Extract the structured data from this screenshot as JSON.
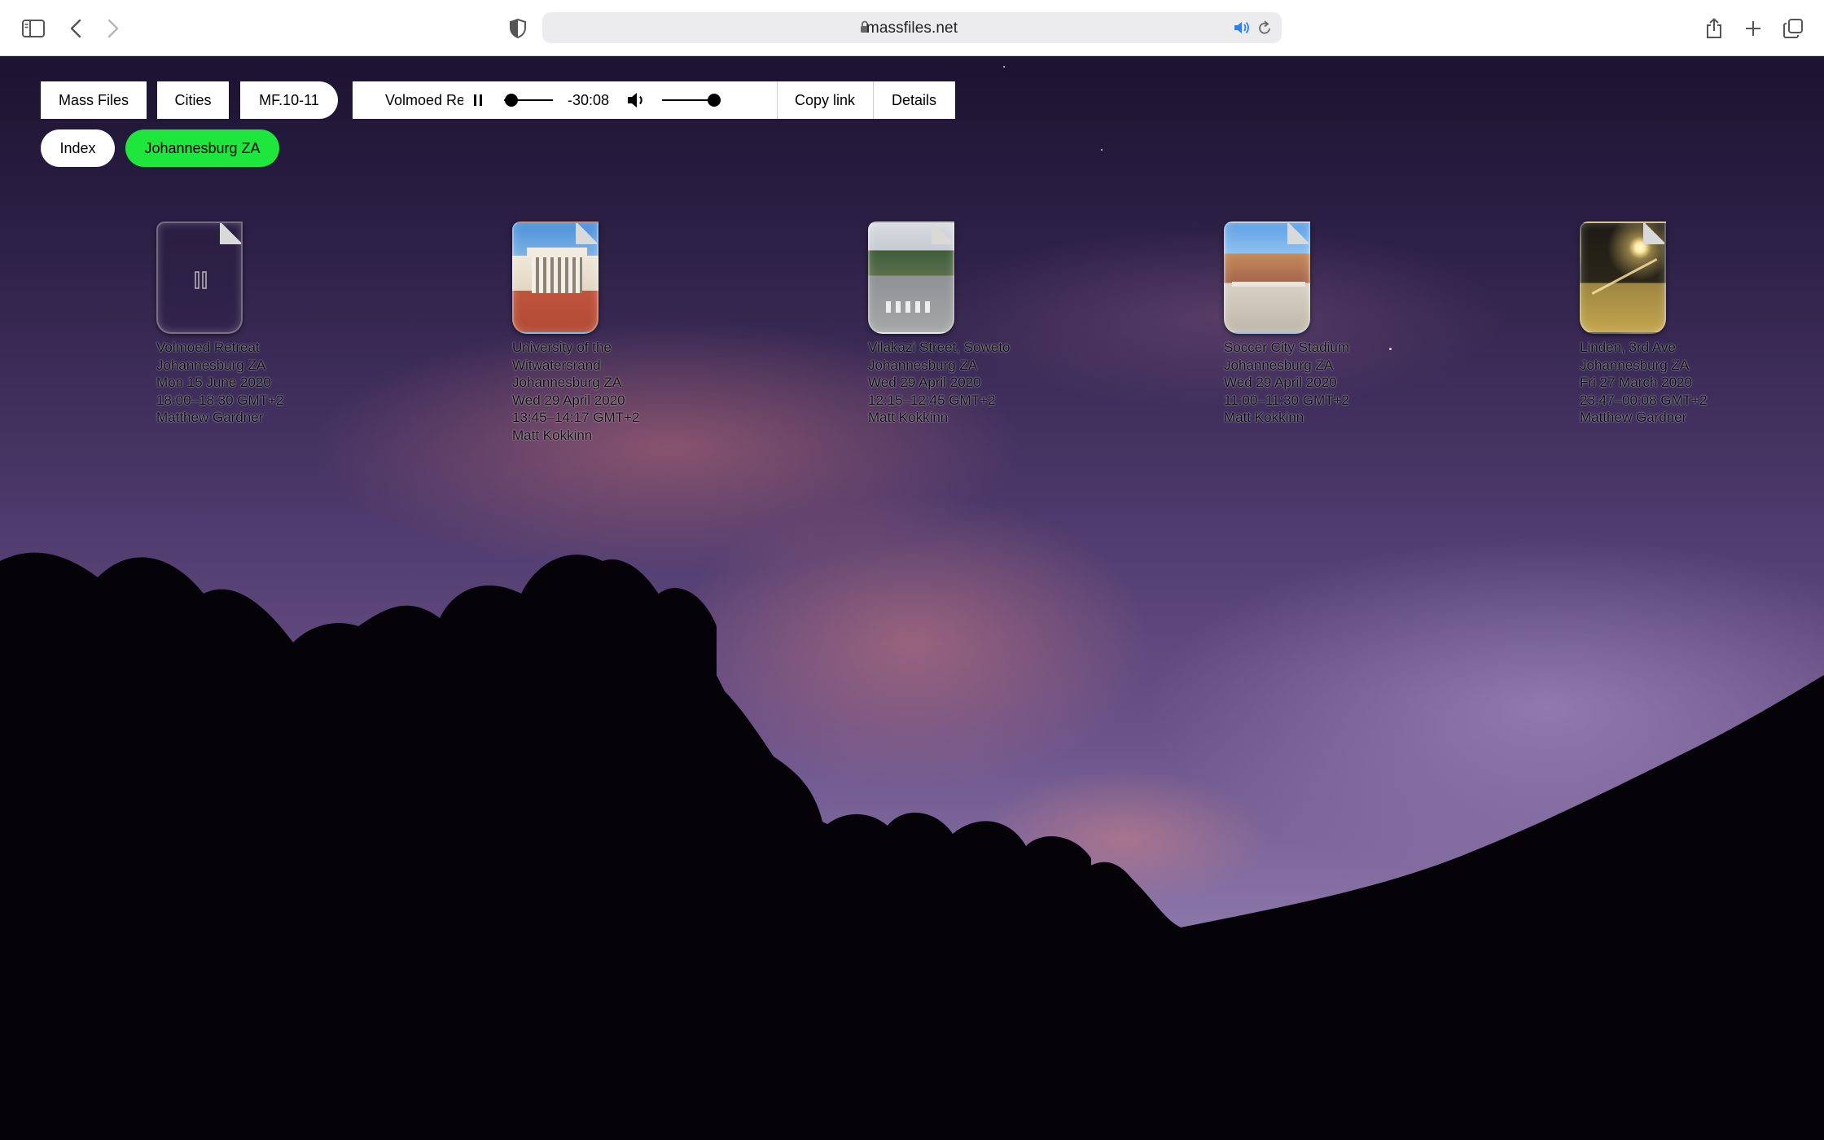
{
  "browser": {
    "url_host": "massfiles.net",
    "icons": {
      "sidebar": "sidebar-icon",
      "back": "chevron-left-icon",
      "forward": "chevron-right-icon",
      "shield": "shield-icon",
      "lock": "lock-icon",
      "speaker": "speaker-icon",
      "reload": "reload-icon",
      "share": "share-icon",
      "new_tab": "plus-icon",
      "tabs": "tabs-overview-icon"
    }
  },
  "nav": {
    "mass_files": "Mass Files",
    "cities": "Cities",
    "edition": "MF.10-11",
    "index": "Index",
    "city": "Johannesburg ZA"
  },
  "player": {
    "title": "Volmoed Retreat",
    "time": "-30:08",
    "progress_fraction": 0.03,
    "volume_fraction": 1.0,
    "copy_link": "Copy link",
    "details": "Details"
  },
  "colors": {
    "accent_green": "#1ee63c"
  },
  "files": [
    {
      "image": "playing-pause",
      "lines": [
        "Volmoed Retreat",
        "Johannesburg ZA",
        "Mon 15 June 2020",
        "18:00–18:30 GMT+2",
        "Matthew Gardner"
      ]
    },
    {
      "image": "university-building",
      "lines": [
        "University of the",
        "Witwatersrand",
        "Johannesburg ZA",
        "Wed 29 April 2020",
        "13:45–14:17 GMT+2",
        "Matt Kokkinn"
      ]
    },
    {
      "image": "street-crossing",
      "lines": [
        "Vilakazi Street, Soweto",
        "Johannesburg ZA",
        "Wed 29 April 2020",
        "12:15–12:45 GMT+2",
        "Matt Kokkinn"
      ]
    },
    {
      "image": "stadium",
      "lines": [
        "Soccer City Stadium",
        "Johannesburg ZA",
        "Wed 29 April 2020",
        "11:00–11:30 GMT+2",
        "Matt Kokkinn"
      ]
    },
    {
      "image": "night-street-light",
      "lines": [
        "Linden, 3rd Ave",
        "Johannesburg ZA",
        "Fri 27 March 2020",
        "23:47–00:08 GMT+2",
        "Matthew Gardner"
      ]
    }
  ]
}
